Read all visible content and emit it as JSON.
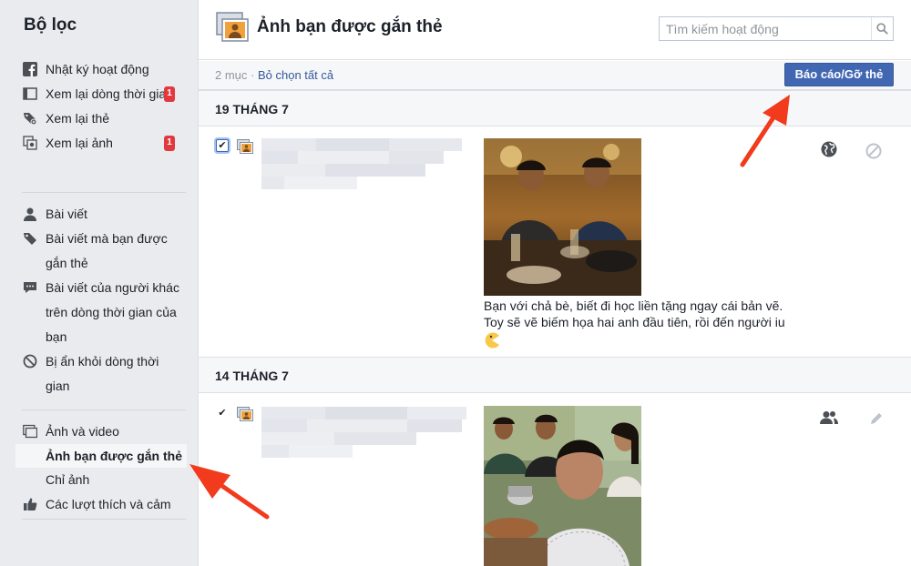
{
  "sidebar": {
    "title": "Bộ lọc",
    "groups": [
      [
        {
          "icon": "facebook-icon",
          "label": "Nhật ký hoạt động"
        },
        {
          "icon": "timeline-icon",
          "label": "Xem lại dòng thời gian",
          "badge": "1"
        },
        {
          "icon": "tag-review-icon",
          "label": "Xem lại thẻ"
        },
        {
          "icon": "photo-review-icon",
          "label": "Xem lại ảnh",
          "badge": "1"
        }
      ],
      [
        {
          "icon": "person-icon",
          "label": "Bài viết"
        },
        {
          "icon": "tag-icon",
          "label": "Bài viết mà bạn được gắn thẻ"
        },
        {
          "icon": "speech-bubble-icon",
          "label": "Bài viết của người khác trên dòng thời gian của bạn"
        },
        {
          "icon": "hidden-icon",
          "label": "Bị ẩn khỏi dòng thời gian"
        }
      ],
      [
        {
          "icon": "photos-videos-icon",
          "label": "Ảnh và video"
        },
        {
          "icon": "",
          "label": "Ảnh bạn được gắn thẻ",
          "active": true
        },
        {
          "icon": "",
          "label": "Chỉ ảnh"
        },
        {
          "icon": "thumbs-up-icon",
          "label": "Các lượt thích và cảm"
        }
      ]
    ]
  },
  "header": {
    "title": "Ảnh bạn được gắn thẻ",
    "search_placeholder": "Tìm kiếm hoạt động"
  },
  "toolbar": {
    "count": "2 mục",
    "separator": " · ",
    "deselect_label": "Bỏ chọn tất cả",
    "report_label": "Báo cáo/Gỡ thẻ"
  },
  "entries": [
    {
      "date": "19 THÁNG 7",
      "caption_line1": "Bạn với chả bè, biết đi học liền tặng ngay cái bản vẽ.",
      "caption_line2": "Toy sẽ vẽ biếm họa hai anh đầu tiên, rồi đến người iu",
      "emoji": "pacman-emoji",
      "privacy_icon": "globe-icon",
      "action_icon": "hide-circle-icon"
    },
    {
      "date": "14 THÁNG 7",
      "privacy_icon": "friends-icon",
      "action_icon": "pencil-icon"
    }
  ],
  "colors": {
    "accent": "#4267b2",
    "link": "#365899",
    "badge": "#e0393e",
    "arrow": "#f23a1d"
  }
}
